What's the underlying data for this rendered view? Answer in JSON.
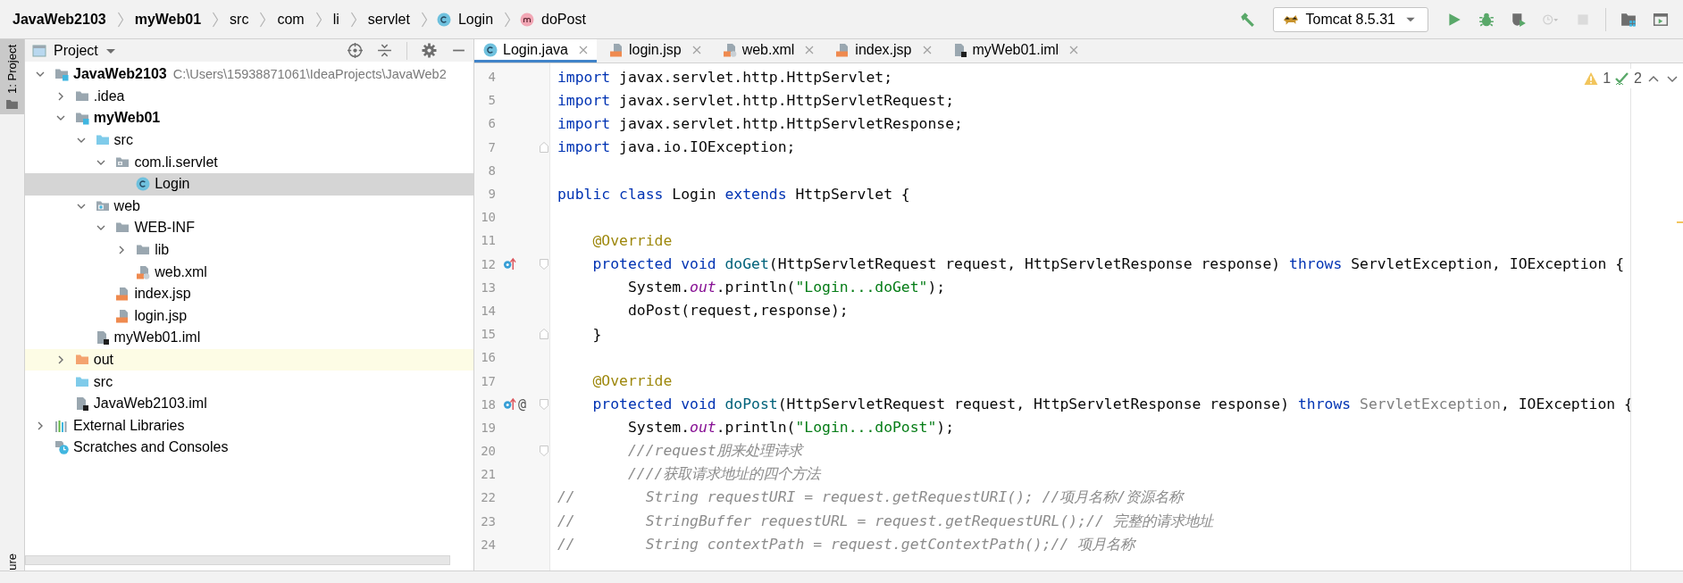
{
  "breadcrumbs": [
    {
      "label": "JavaWeb2103",
      "kind": "module"
    },
    {
      "label": "myWeb01",
      "kind": "module"
    },
    {
      "label": "src",
      "kind": "folder"
    },
    {
      "label": "com",
      "kind": "folder"
    },
    {
      "label": "li",
      "kind": "folder"
    },
    {
      "label": "servlet",
      "kind": "folder"
    },
    {
      "label": "Login",
      "kind": "class"
    },
    {
      "label": "doPost",
      "kind": "method"
    }
  ],
  "toolbar": {
    "run_config": "Tomcat 8.5.31",
    "buttons": [
      {
        "kind": "build",
        "disabled": false
      },
      {
        "kind": "run",
        "disabled": false
      },
      {
        "kind": "debug",
        "disabled": false
      },
      {
        "kind": "coverage",
        "disabled": false
      },
      {
        "kind": "profile",
        "disabled": true
      },
      {
        "kind": "stop",
        "disabled": true
      },
      {
        "kind": "structure",
        "disabled": false
      },
      {
        "kind": "layout",
        "disabled": false
      }
    ]
  },
  "side_stripe": {
    "top_tab": "1: Project",
    "bottom_tab": "ure"
  },
  "project": {
    "title": "Project",
    "tree": [
      {
        "label": "JavaWeb2103",
        "kind": "module",
        "hint": "C:\\Users\\15938871061\\IdeaProjects\\JavaWeb2",
        "expanded": true,
        "selected": false,
        "children": [
          {
            "label": ".idea",
            "kind": "folder",
            "expanded": false,
            "selected": false
          },
          {
            "label": "myWeb01",
            "kind": "module",
            "expanded": true,
            "selected": false,
            "children": [
              {
                "label": "src",
                "kind": "source-folder",
                "expanded": true,
                "selected": false,
                "children": [
                  {
                    "label": "com.li.servlet",
                    "kind": "package",
                    "expanded": true,
                    "selected": false,
                    "children": [
                      {
                        "label": "Login",
                        "kind": "class",
                        "selected": true
                      }
                    ]
                  }
                ]
              },
              {
                "label": "web",
                "kind": "web-folder",
                "expanded": true,
                "selected": false,
                "children": [
                  {
                    "label": "WEB-INF",
                    "kind": "folder",
                    "expanded": true,
                    "selected": false,
                    "children": [
                      {
                        "label": "lib",
                        "kind": "folder",
                        "expanded": false,
                        "selected": false
                      },
                      {
                        "label": "web.xml",
                        "kind": "xml",
                        "selected": false
                      }
                    ]
                  },
                  {
                    "label": "index.jsp",
                    "kind": "jsp",
                    "selected": false
                  },
                  {
                    "label": "login.jsp",
                    "kind": "jsp",
                    "selected": false
                  }
                ]
              },
              {
                "label": "myWeb01.iml",
                "kind": "iml",
                "selected": false
              }
            ]
          },
          {
            "label": "out",
            "kind": "excluded-folder",
            "expanded": false,
            "selected": false
          },
          {
            "label": "src",
            "kind": "source-folder",
            "selected": false
          },
          {
            "label": "JavaWeb2103.iml",
            "kind": "iml",
            "selected": false
          }
        ]
      },
      {
        "label": "External Libraries",
        "kind": "libraries",
        "expanded": false,
        "selected": false
      },
      {
        "label": "Scratches and Consoles",
        "kind": "scratches",
        "selected": false
      }
    ]
  },
  "editor": {
    "tabs": [
      {
        "label": "Login.java",
        "kind": "class",
        "selected": true
      },
      {
        "label": "login.jsp",
        "kind": "jsp",
        "selected": false
      },
      {
        "label": "web.xml",
        "kind": "xml",
        "selected": false
      },
      {
        "label": "index.jsp",
        "kind": "jsp",
        "selected": false
      },
      {
        "label": "myWeb01.iml",
        "kind": "iml",
        "selected": false
      }
    ],
    "inspections": {
      "warnings": "1",
      "weak_warnings": "2"
    },
    "lines": [
      {
        "number": "4",
        "tokens": [
          {
            "kind": "k",
            "text": "import"
          },
          {
            "kind": "p",
            "text": " javax.servlet.http.HttpServlet;"
          }
        ]
      },
      {
        "number": "5",
        "tokens": [
          {
            "kind": "k",
            "text": "import"
          },
          {
            "kind": "p",
            "text": " javax.servlet.http.HttpServletRequest;"
          }
        ]
      },
      {
        "number": "6",
        "tokens": [
          {
            "kind": "k",
            "text": "import"
          },
          {
            "kind": "p",
            "text": " javax.servlet.http.HttpServletResponse;"
          }
        ]
      },
      {
        "number": "7",
        "markers": [
          {
            "kind": "fold-end"
          }
        ],
        "tokens": [
          {
            "kind": "k",
            "text": "import"
          },
          {
            "kind": "p",
            "text": " java.io.IOException;"
          }
        ]
      },
      {
        "number": "8"
      },
      {
        "number": "9",
        "tokens": [
          {
            "kind": "k",
            "text": "public class"
          },
          {
            "kind": "p",
            "text": " Login "
          },
          {
            "kind": "k",
            "text": "extends"
          },
          {
            "kind": "p",
            "text": " HttpServlet {"
          }
        ]
      },
      {
        "number": "10"
      },
      {
        "number": "11",
        "tokens": [
          {
            "kind": "a",
            "text": "    @Override"
          }
        ]
      },
      {
        "number": "12",
        "markers": [
          {
            "kind": "override"
          },
          {
            "kind": "fold-start"
          }
        ],
        "tokens": [
          {
            "kind": "k",
            "text": "    protected void "
          },
          {
            "kind": "d",
            "text": "doGet"
          },
          {
            "kind": "p",
            "text": "(HttpServletRequest request, HttpServletResponse response) "
          },
          {
            "kind": "k",
            "text": "throws"
          },
          {
            "kind": "p",
            "text": " ServletException, IOException {"
          }
        ]
      },
      {
        "number": "13",
        "tokens": [
          {
            "kind": "p",
            "text": "        System."
          },
          {
            "kind": "f",
            "text": "out"
          },
          {
            "kind": "p",
            "text": ".println("
          },
          {
            "kind": "s",
            "text": "\"Login...doGet\""
          },
          {
            "kind": "p",
            "text": ");"
          }
        ]
      },
      {
        "number": "14",
        "tokens": [
          {
            "kind": "p",
            "text": "        doPost(request,response);"
          }
        ]
      },
      {
        "number": "15",
        "markers": [
          {
            "kind": "fold-end"
          }
        ],
        "tokens": [
          {
            "kind": "p",
            "text": "    }"
          }
        ]
      },
      {
        "number": "16"
      },
      {
        "number": "17",
        "tokens": [
          {
            "kind": "a",
            "text": "    @Override"
          }
        ]
      },
      {
        "number": "18",
        "markers": [
          {
            "kind": "override"
          },
          {
            "kind": "text",
            "text": "@"
          },
          {
            "kind": "fold-start"
          }
        ],
        "tokens": [
          {
            "kind": "k",
            "text": "    protected void "
          },
          {
            "kind": "d",
            "text": "doPost"
          },
          {
            "kind": "p",
            "text": "(HttpServletRequest request, HttpServletResponse response) "
          },
          {
            "kind": "k",
            "text": "throws"
          },
          {
            "kind": "u",
            "text": " ServletException"
          },
          {
            "kind": "p",
            "text": ", IOException {"
          }
        ]
      },
      {
        "number": "19",
        "tokens": [
          {
            "kind": "p",
            "text": "        System."
          },
          {
            "kind": "f",
            "text": "out"
          },
          {
            "kind": "p",
            "text": ".println("
          },
          {
            "kind": "s",
            "text": "\"Login...doPost\""
          },
          {
            "kind": "p",
            "text": ");"
          }
        ]
      },
      {
        "number": "20",
        "markers": [
          {
            "kind": "fold-start"
          }
        ],
        "tokens": [
          {
            "kind": "c",
            "text": "        ///request朋来处理诗求"
          }
        ]
      },
      {
        "number": "21",
        "tokens": [
          {
            "kind": "c",
            "text": "        ////获取请求地址的四个方法"
          }
        ]
      },
      {
        "number": "22",
        "tokens": [
          {
            "kind": "c",
            "text": "//        String requestURI = request.getRequestURI(); //项月名称/资源名称"
          }
        ]
      },
      {
        "number": "23",
        "tokens": [
          {
            "kind": "c",
            "text": "//        StringBuffer requestURL = request.getRequestURL();// 完整的请求地址"
          }
        ]
      },
      {
        "number": "24",
        "tokens": [
          {
            "kind": "c",
            "text": "//        String contextPath = request.getContextPath();// 项月名称"
          }
        ]
      }
    ]
  }
}
